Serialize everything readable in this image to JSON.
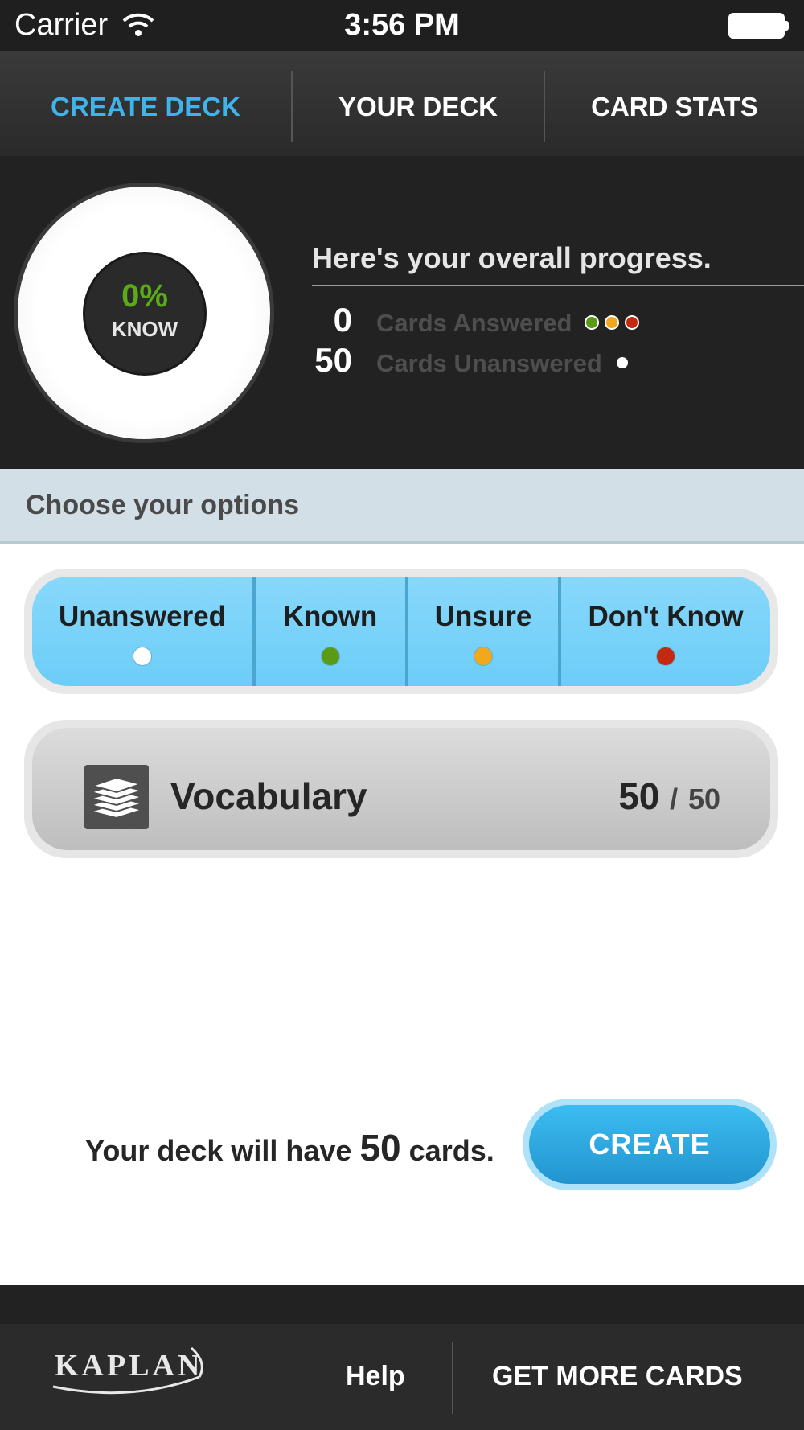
{
  "status_bar": {
    "carrier": "Carrier",
    "time": "3:56 PM"
  },
  "tabs": [
    {
      "label": "CREATE DECK",
      "active": true
    },
    {
      "label": "YOUR DECK",
      "active": false
    },
    {
      "label": "CARD STATS",
      "active": false
    }
  ],
  "progress": {
    "percent_text": "0%",
    "percent_label": "KNOW",
    "title": "Here's your overall progress.",
    "answered_count": "0",
    "answered_label": "Cards Answered",
    "unanswered_count": "50",
    "unanswered_label": "Cards Unanswered"
  },
  "options": {
    "header": "Choose your options",
    "filters": [
      {
        "label": "Unanswered",
        "dot_color": "#ffffff"
      },
      {
        "label": "Known",
        "dot_color": "#5a9a14"
      },
      {
        "label": "Unsure",
        "dot_color": "#f2a81c"
      },
      {
        "label": "Don't Know",
        "dot_color": "#c42a10"
      }
    ]
  },
  "deck": {
    "name": "Vocabulary",
    "selected": "50",
    "separator": "/",
    "total": "50",
    "icon": "card-stack-icon"
  },
  "create": {
    "summary_prefix": "Your deck will have",
    "summary_count": "50",
    "summary_suffix": "cards.",
    "button_label": "CREATE"
  },
  "footer": {
    "logo": "KAPLAN",
    "help": "Help",
    "more": "GET MORE CARDS"
  },
  "colors": {
    "accent": "#3fb3ea",
    "known": "#5a9a14",
    "unsure": "#f2a81c",
    "dont_know": "#c42a10"
  }
}
